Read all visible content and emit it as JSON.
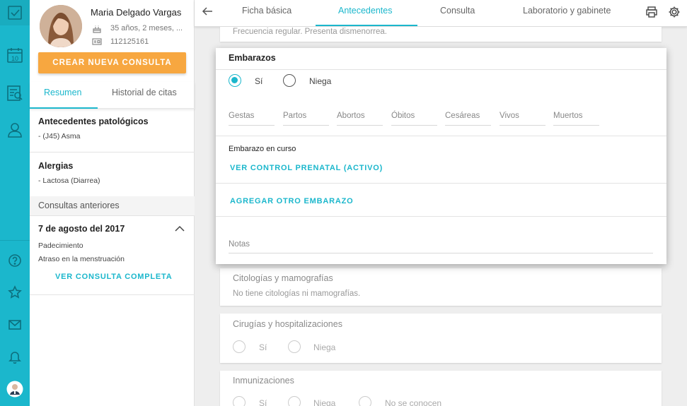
{
  "rail": {
    "icons": [
      "check-icon",
      "calendar-icon",
      "patient-list-icon",
      "user-icon",
      "help-icon",
      "star-icon",
      "mail-icon",
      "bell-icon",
      "profile-avatar"
    ],
    "calendar_day": "10"
  },
  "patient": {
    "name": "Maria Delgado Vargas",
    "age": "35 años, 2 meses, ...",
    "id": "112125161",
    "new_consult_label": "CREAR NUEVA CONSULTA",
    "tabs": [
      "Resumen",
      "Historial de citas"
    ],
    "pathological_title": "Antecedentes patológicos",
    "pathological_value": "- (J45) Asma",
    "allergies_title": "Alergias",
    "allergies_value": "- Lactosa (Diarrea)",
    "previous_title": "Consultas anteriores",
    "consult_date": "7 de agosto del 2017",
    "condition_label": "Padecimiento",
    "condition_value": "Atraso en la menstruación",
    "full_consult_link": "VER CONSULTA COMPLETA"
  },
  "topbar": {
    "tabs": [
      "Ficha básica",
      "Antecedentes",
      "Consulta",
      "Laboratorio y gabinete"
    ],
    "active_tab": "Antecedentes"
  },
  "main": {
    "menstrual_text": "Frecuencia regular. Presenta dismenorrea.",
    "pregnancies": {
      "title": "Embarazos",
      "yes_label": "Sí",
      "no_label": "Niega",
      "selected": "Sí",
      "fields": [
        "Gestas",
        "Partos",
        "Abortos",
        "Óbitos",
        "Cesáreas",
        "Vivos",
        "Muertos"
      ],
      "current_label": "Embarazo en curso",
      "prenatal_link": "VER CONTROL PRENATAL (ACTIVO)",
      "add_link": "AGREGAR OTRO EMBARAZO",
      "notes_placeholder": "Notas"
    },
    "cytology": {
      "title": "Citologías y mamografías",
      "text": "No tiene citologías ni mamografías."
    },
    "surgeries": {
      "title": "Cirugías y hospitalizaciones",
      "yes_label": "Sí",
      "no_label": "Niega"
    },
    "immunizations": {
      "title": "Inmunizaciones",
      "yes_label": "Sí",
      "no_label": "Niega",
      "unknown_label": "No se conocen"
    }
  },
  "colors": {
    "accent": "#1bb7cc",
    "button": "#f7a740",
    "rail": "#1bb7cc"
  }
}
